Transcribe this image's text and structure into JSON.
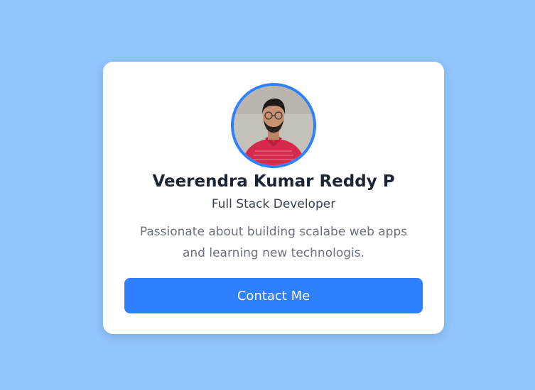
{
  "profile": {
    "name": "Veerendra Kumar Reddy P",
    "role": "Full Stack Developer",
    "bio_lines": [
      "Passionate about building scalabe web apps",
      "and learning new technologis."
    ],
    "contact_label": "Contact Me",
    "avatar_alt": "profile photo"
  },
  "colors": {
    "background": "#90c4fc",
    "card": "#ffffff",
    "accent": "#2f80ff",
    "name_text": "#1d2533",
    "role_text": "#374151",
    "bio_text": "#6b7280"
  }
}
